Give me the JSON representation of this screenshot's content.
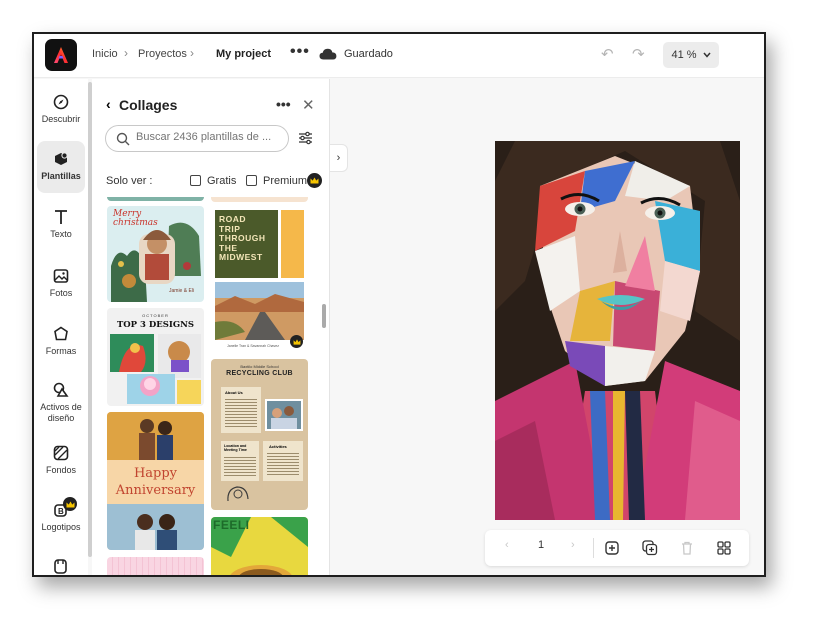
{
  "header": {
    "breadcrumb": [
      "Inicio",
      "Proyectos"
    ],
    "project_name": "My project",
    "status": "Guardado",
    "zoom": "41 %"
  },
  "rail": {
    "items": [
      {
        "label": "Descubrir",
        "icon": "compass-icon"
      },
      {
        "label": "Plantillas",
        "icon": "templates-icon"
      },
      {
        "label": "Texto",
        "icon": "text-icon"
      },
      {
        "label": "Fotos",
        "icon": "image-icon"
      },
      {
        "label": "Formas",
        "icon": "shapes-icon"
      },
      {
        "label": "Activos de diseño",
        "icon": "assets-icon"
      },
      {
        "label": "Fondos",
        "icon": "background-icon"
      },
      {
        "label": "Logotipos",
        "icon": "logo-icon"
      }
    ],
    "active": "Plantillas"
  },
  "panel": {
    "title": "Collages",
    "search_placeholder": "Buscar 2436 plantillas de ...",
    "show_label": "Solo ver :",
    "filter_free": "Gratis",
    "filter_premium": "Premium",
    "templates": [
      {
        "title_lines": [
          "Merry",
          "christmas"
        ],
        "footer": "Jamie & Eli",
        "premium": false
      },
      {
        "title_lines": [
          "ROAD",
          "TRIP",
          "THROUGH",
          "THE",
          "MIDWEST"
        ],
        "footer": "Janelle Tran & Savannah Chavez",
        "premium": true
      },
      {
        "kicker": "OCTOBER",
        "title_lines": [
          "TOP 3 DESIGNS"
        ],
        "premium": false
      },
      {
        "kicker": "Baxtilo Middle School",
        "title_lines": [
          "RECYCLING CLUB"
        ],
        "sections": [
          "About Us",
          "Location and Meeting Time",
          "Activities"
        ],
        "premium": false
      },
      {
        "title_lines": [
          "Happy",
          "Anniversary"
        ],
        "premium": false
      },
      {
        "title_lines": [
          "FEELI"
        ],
        "premium": false
      }
    ]
  },
  "pagination": {
    "current_page": "1"
  },
  "colors": {
    "accent": "#eb1000",
    "premium_badge": "#f5c400"
  }
}
